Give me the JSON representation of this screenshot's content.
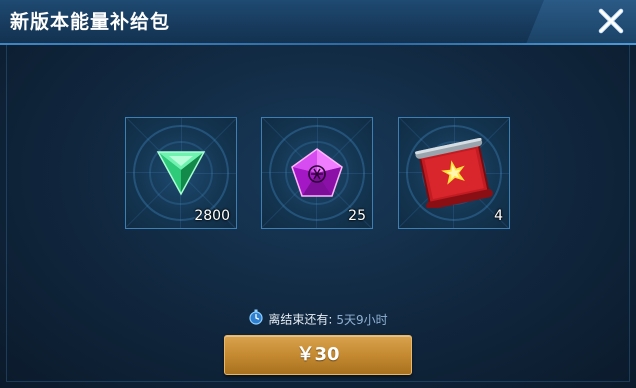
{
  "dialog": {
    "title": "新版本能量补给包"
  },
  "items": [
    {
      "name": "green-crystal",
      "count": "2800",
      "icon": "green-triangle-gem-icon"
    },
    {
      "name": "purple-crystal",
      "count": "25",
      "icon": "purple-pentagon-gem-icon"
    },
    {
      "name": "red-scroll",
      "count": "4",
      "icon": "red-scroll-icon"
    }
  ],
  "timer": {
    "label": "离结束还有:",
    "value": "5天9小时",
    "icon": "stopwatch-icon"
  },
  "buy_button": {
    "label": "￥30"
  },
  "colors": {
    "accent": "#3d7fb3",
    "button_gold": "#c58a32",
    "timer_value": "#8fb2d4"
  }
}
